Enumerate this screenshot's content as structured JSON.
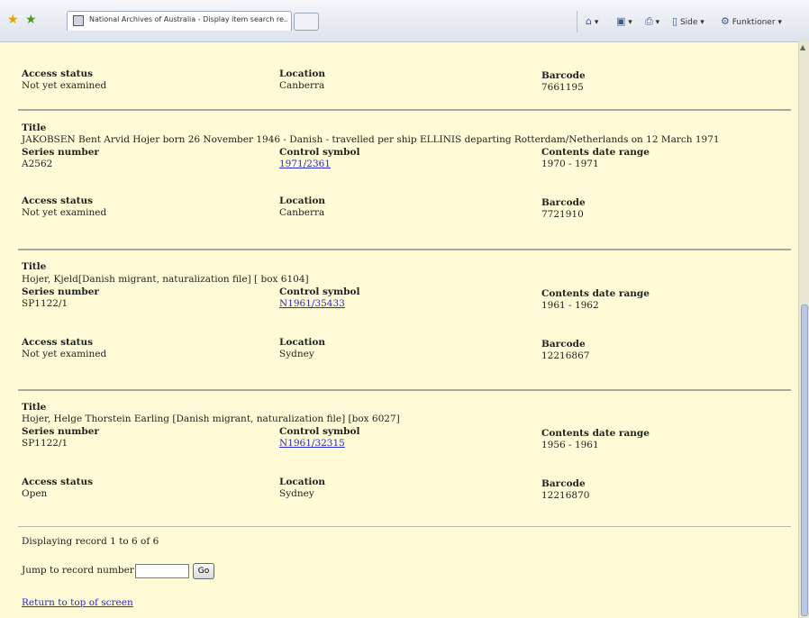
{
  "browser": {
    "tab_title": "National Archives of Australia - Display item search re...",
    "toolbar": {
      "page_label": "Side",
      "tools_label": "Funktioner"
    }
  },
  "top_record": {
    "access_label": "Access status",
    "access_value": "Not yet examined",
    "location_label": "Location",
    "location_value": "Canberra",
    "barcode_label": "Barcode",
    "barcode_value": "7661195"
  },
  "records": [
    {
      "title_label": "Title",
      "title": "JAKOBSEN Bent Arvid Hojer born 26 November 1946 - Danish - travelled per ship ELLINIS departing Rotterdam/Netherlands on 12 March 1971",
      "series_label": "Series number",
      "series": "A2562",
      "control_label": "Control symbol",
      "control": "1971/2361",
      "date_label": "Contents date range",
      "date_range": "1970 - 1971",
      "access_label": "Access status",
      "access": "Not yet examined",
      "location_label": "Location",
      "location": "Canberra",
      "barcode_label": "Barcode",
      "barcode": "7721910"
    },
    {
      "title_label": "Title",
      "title": "Hojer, Kjeld[Danish migrant, naturalization file] [ box 6104]",
      "series_label": "Series number",
      "series": "SP1122/1",
      "control_label": "Control symbol",
      "control": "N1961/35433",
      "date_label": "Contents date range",
      "date_range": "1961 - 1962",
      "access_label": "Access status",
      "access": "Not yet examined",
      "location_label": "Location",
      "location": "Sydney",
      "barcode_label": "Barcode",
      "barcode": "12216867"
    },
    {
      "title_label": "Title",
      "title": "Hojer, Helge Thorstein Earling [Danish migrant, naturalization file] [box 6027]",
      "series_label": "Series number",
      "series": "SP1122/1",
      "control_label": "Control symbol",
      "control": "N1961/32315",
      "date_label": "Contents date range",
      "date_range": "1956 - 1961",
      "access_label": "Access status",
      "access": "Open",
      "location_label": "Location",
      "location": "Sydney",
      "barcode_label": "Barcode",
      "barcode": "12216870"
    }
  ],
  "footer": {
    "display_text": "Displaying record 1 to 6 of 6",
    "jump_label": "Jump to record number",
    "go_label": "Go",
    "return_link": "Return to top of screen"
  }
}
